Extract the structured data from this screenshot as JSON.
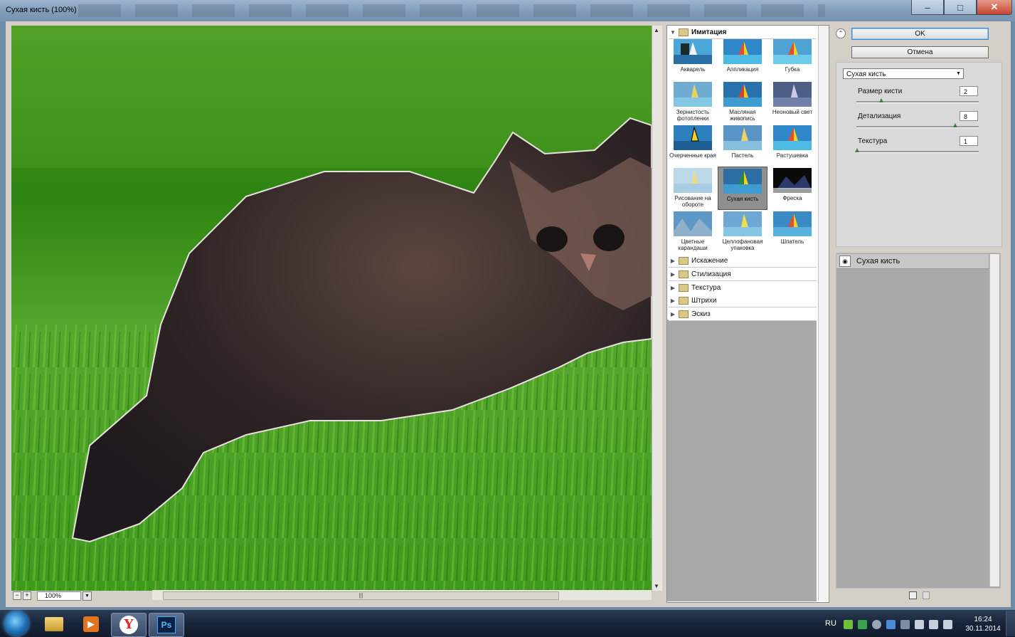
{
  "window": {
    "title": "Сухая кисть (100%)",
    "buttons": [
      "–",
      "□",
      "✕"
    ]
  },
  "preview": {
    "zoom": "100%"
  },
  "gallery": {
    "open_category": "Имитация",
    "filters": [
      {
        "label": "Акварель"
      },
      {
        "label": "Аппликация"
      },
      {
        "label": "Губка"
      },
      {
        "label": "Зернистость фотопленки"
      },
      {
        "label": "Масляная живопись"
      },
      {
        "label": "Неоновый свет"
      },
      {
        "label": "Очерченные края"
      },
      {
        "label": "Пастель"
      },
      {
        "label": "Растушевка"
      },
      {
        "label": "Рисование на обороте"
      },
      {
        "label": "Сухая кисть"
      },
      {
        "label": "Фреска"
      },
      {
        "label": "Цветные карандаши"
      },
      {
        "label": "Целлофановая упаковка"
      },
      {
        "label": "Шпатель"
      }
    ],
    "selected": "Сухая кисть",
    "categories": [
      "Искажение",
      "Стилизация",
      "Текстура",
      "Штрихи",
      "Эскиз"
    ]
  },
  "buttons": {
    "ok": "OK",
    "cancel": "Отмена"
  },
  "settings": {
    "filter_select": "Сухая кисть",
    "params": [
      {
        "label": "Размер кисти",
        "value": "2",
        "level": 0.2
      },
      {
        "label": "Детализация",
        "value": "8",
        "level": 0.8
      },
      {
        "label": "Текстура",
        "value": "1",
        "level": 0.0
      }
    ]
  },
  "layers": {
    "items": [
      {
        "label": "Сухая кисть"
      }
    ]
  },
  "taskbar": {
    "lang": "RU",
    "time": "16:24",
    "date": "30.11.2014",
    "apps": [
      "explorer-icon",
      "media-player-icon",
      "yandex-browser-icon",
      "photoshop-icon"
    ],
    "ps_label": "Ps"
  },
  "colors": {
    "ok_border": "#3a8ad4",
    "grass": "#3d8f1d",
    "taskbar": "#18243a"
  }
}
